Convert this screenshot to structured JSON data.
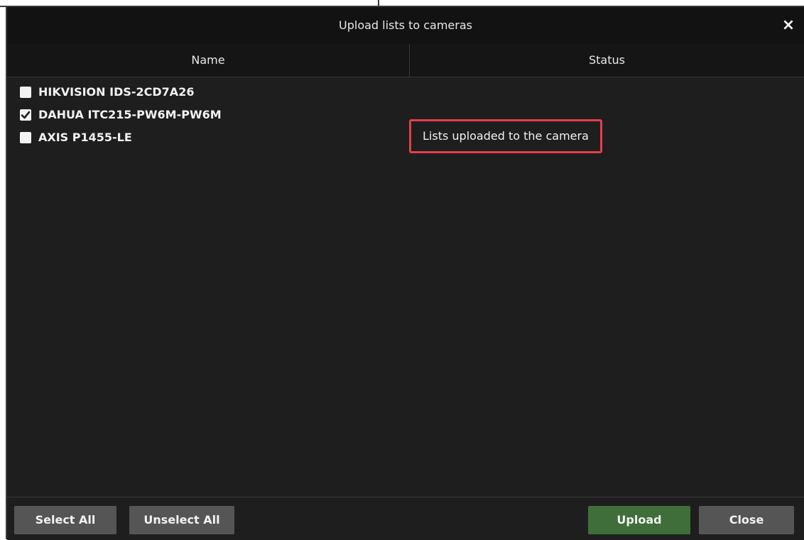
{
  "dialog": {
    "title": "Upload lists to cameras",
    "close_icon": "×"
  },
  "table": {
    "columns": [
      "Name",
      "Status"
    ],
    "rows": [
      {
        "name": "HIKVISION IDS-2CD7A26",
        "checked": false,
        "status": ""
      },
      {
        "name": "DAHUA ITC215-PW6M-PW6M",
        "checked": true,
        "status": "Lists uploaded to the camera"
      },
      {
        "name": "AXIS P1455-LE",
        "checked": false,
        "status": ""
      }
    ]
  },
  "footer": {
    "select_all": "Select All",
    "unselect_all": "Unselect All",
    "upload": "Upload",
    "close": "Close"
  },
  "colors": {
    "upload_button": "#3f6e3a",
    "highlight_border": "#e53e4a"
  }
}
